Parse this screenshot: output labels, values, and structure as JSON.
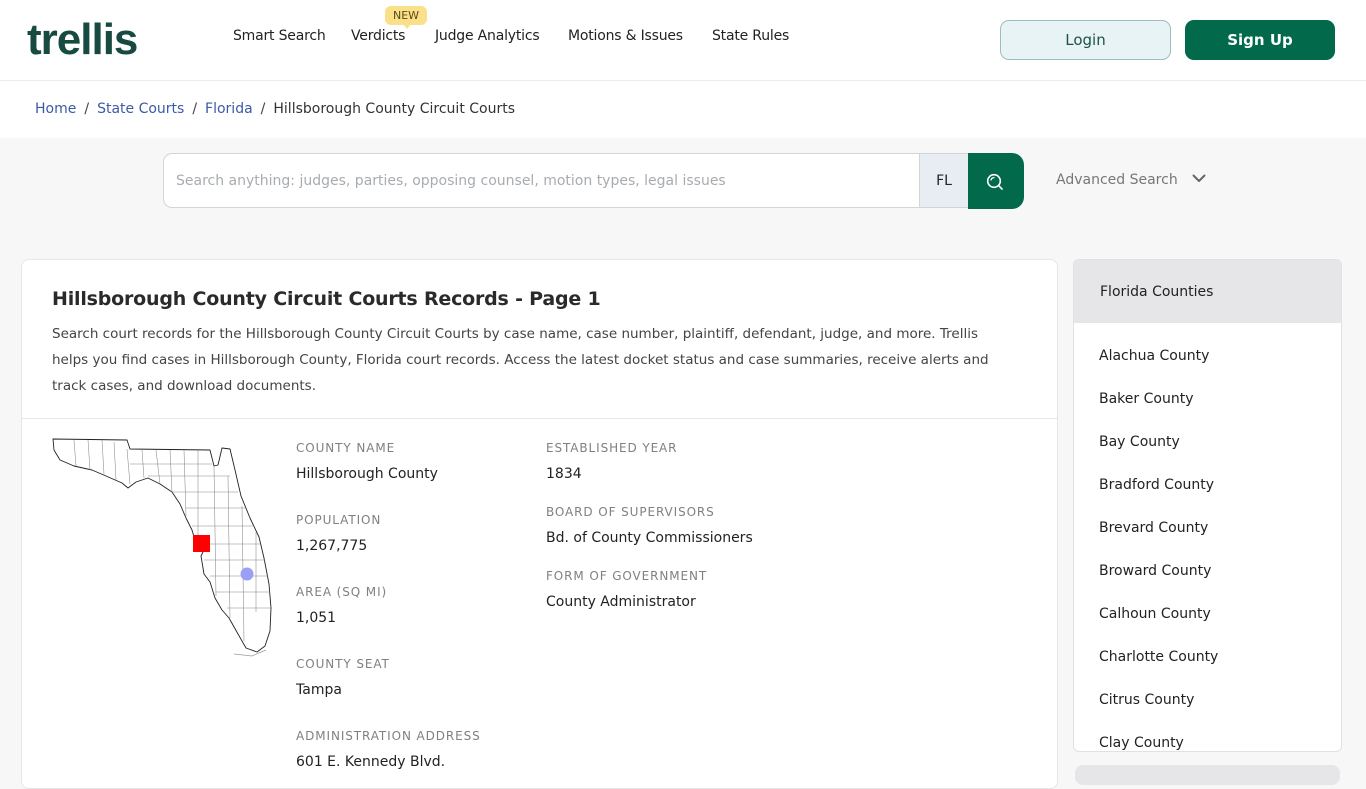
{
  "header": {
    "logo": "trellis",
    "nav": [
      {
        "label": "Smart Search"
      },
      {
        "label": "Verdicts",
        "badge": "NEW"
      },
      {
        "label": "Judge Analytics"
      },
      {
        "label": "Motions & Issues"
      },
      {
        "label": "State Rules"
      }
    ],
    "login_label": "Login",
    "signup_label": "Sign Up"
  },
  "breadcrumb": {
    "items": [
      "Home",
      "State Courts",
      "Florida"
    ],
    "current": "Hillsborough County Circuit Courts",
    "separator": "/"
  },
  "search": {
    "placeholder": "Search anything: judges, parties, opposing counsel, motion types, legal issues",
    "value": "",
    "state": "FL",
    "advanced_label": "Advanced Search"
  },
  "main": {
    "title": "Hillsborough County Circuit Courts Records - Page 1",
    "description": "Search court records for the Hillsborough County Circuit Courts by case name, case number, plaintiff, defendant, judge, and more. Trellis helps you find cases in Hillsborough County, Florida court records. Access the latest docket status and case summaries, receive alerts and track cases, and download documents.",
    "map": {
      "highlight_county": "Hillsborough County",
      "highlight_color": "#ff0000",
      "lake_color": "#9aa0f5"
    },
    "fields_left": [
      {
        "label": "County Name",
        "value": "Hillsborough County"
      },
      {
        "label": "Population",
        "value": "1,267,775"
      },
      {
        "label": "Area (sq mi)",
        "value": "1,051"
      },
      {
        "label": "County Seat",
        "value": "Tampa"
      },
      {
        "label": "Administration Address",
        "value": "601 E. Kennedy Blvd."
      }
    ],
    "fields_right": [
      {
        "label": "Established Year",
        "value": "1834"
      },
      {
        "label": "Board of Supervisors",
        "value": "Bd. of County Commissioners"
      },
      {
        "label": "Form of Government",
        "value": "County Administrator"
      }
    ]
  },
  "sidebar": {
    "title": "Florida Counties",
    "items": [
      "Alachua County",
      "Baker County",
      "Bay County",
      "Bradford County",
      "Brevard County",
      "Broward County",
      "Calhoun County",
      "Charlotte County",
      "Citrus County",
      "Clay County"
    ]
  },
  "colors": {
    "brand_dark": "#174a40",
    "brand_green": "#02694a",
    "link_blue": "#3d5aa8",
    "badge_yellow": "#fbe08a"
  }
}
